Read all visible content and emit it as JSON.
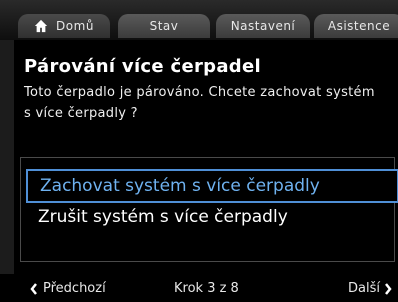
{
  "tabs": {
    "home": "Domů",
    "status": "Stav",
    "settings": "Nastavení",
    "assist": "Asistence"
  },
  "page": {
    "title": "Párování více čerpadel",
    "description": "Toto čerpadlo je párováno. Chcete zachovat systém s více čerpadly ?"
  },
  "options": [
    {
      "label": "Zachovat systém s více čerpadly",
      "selected": true
    },
    {
      "label": "Zrušit systém s více čerpadly",
      "selected": false
    }
  ],
  "footer": {
    "prev": "Předchozí",
    "step": "Krok 3 z 8",
    "next": "Další"
  },
  "icons": {
    "home": "home-icon",
    "prev": "chevron-left-icon",
    "next": "chevron-right-icon"
  },
  "colors": {
    "selection_border": "#4f8fd6",
    "selection_text": "#6fb2f0"
  }
}
